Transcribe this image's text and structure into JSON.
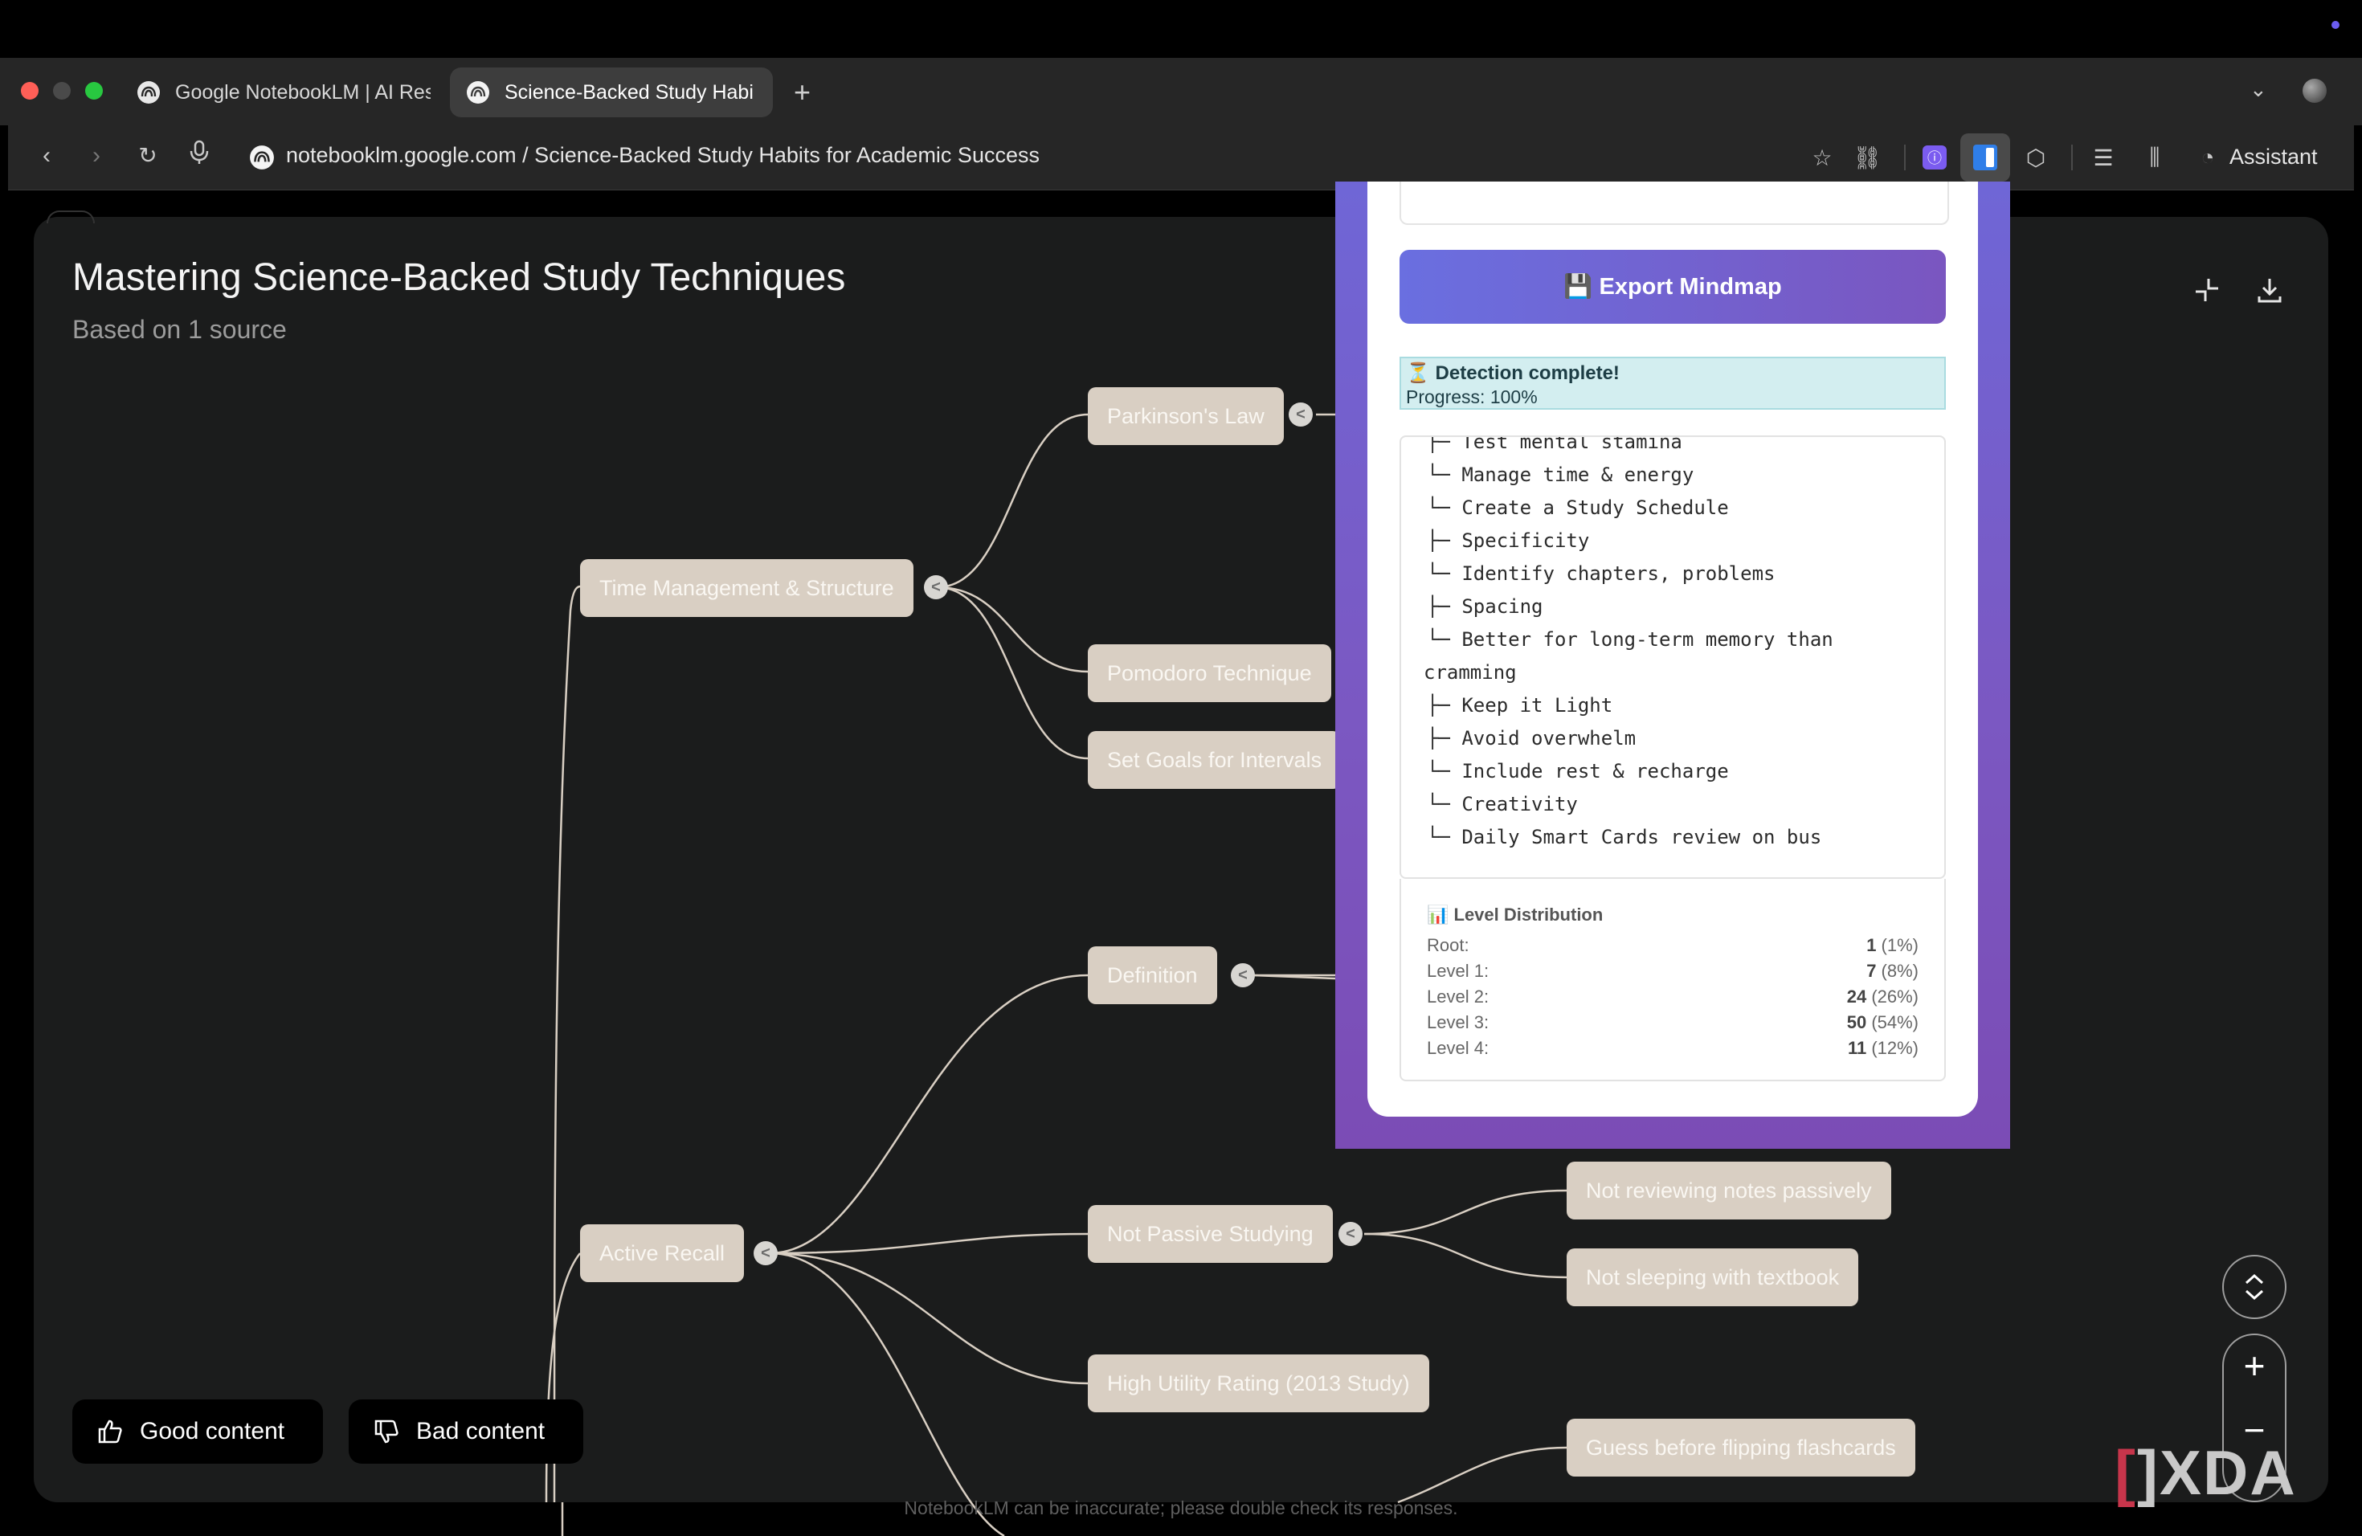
{
  "window": {
    "tabs": [
      {
        "label": "Google NotebookLM | AI Res",
        "active": false
      },
      {
        "label": "Science-Backed Study Habi",
        "active": true
      }
    ],
    "new_tab_symbol": "+",
    "url": "notebooklm.google.com / Science-Backed Study Habits for Academic Success",
    "assistant_label": "Assistant"
  },
  "page": {
    "title": "Mastering Science-Backed Study Techniques",
    "subtitle": "Based on 1 source",
    "footer_note": "NotebookLM can be inaccurate; please double check its responses."
  },
  "mindmap": {
    "nodes": {
      "time_management": "Time Management & Structure",
      "parkinsons_law": "Parkinson's Law",
      "pomodoro": "Pomodoro Technique",
      "set_goals": "Set Goals for Intervals",
      "definition": "Definition",
      "active_recall": "Active Recall",
      "not_passive": "Not Passive Studying",
      "not_reviewing": "Not reviewing notes passively",
      "not_sleeping": "Not sleeping with textbook",
      "high_utility": "High Utility Rating (2013 Study)",
      "guess_before": "Guess before flipping flashcards"
    },
    "toggle_symbol": "<"
  },
  "extension": {
    "export_button": "💾 Export Mindmap",
    "status_title": "⏳ Detection complete!",
    "status_progress": "Progress: 100%",
    "outline": [
      "├─ Test mental stamina",
      "└─ Manage time & energy",
      "└─ Create a Study Schedule",
      "├─ Specificity",
      "└─ Identify chapters, problems",
      "├─ Spacing",
      "└─ Better for long-term memory than",
      "cramming",
      "├─ Keep it Light",
      "├─ Avoid overwhelm",
      "└─ Include rest & recharge",
      "└─ Creativity",
      "└─ Daily Smart Cards review on bus"
    ],
    "distribution": {
      "title": "📊 Level Distribution",
      "rows": [
        {
          "label": "Root:",
          "count": "1",
          "pct": " (1%)"
        },
        {
          "label": "Level 1:",
          "count": "7",
          "pct": " (8%)"
        },
        {
          "label": "Level 2:",
          "count": "24",
          "pct": " (26%)"
        },
        {
          "label": "Level 3:",
          "count": "50",
          "pct": " (54%)"
        },
        {
          "label": "Level 4:",
          "count": "11",
          "pct": " (12%)"
        }
      ]
    }
  },
  "feedback": {
    "good": "Good content",
    "bad": "Bad content"
  },
  "zoom": {
    "plus": "+",
    "minus": "−"
  },
  "watermark": "XDA",
  "colors": {
    "node_bg": "#d9cfc3",
    "canvas_bg": "#1b1c1c",
    "accent_gradient_start": "#6a6fe0",
    "accent_gradient_end": "#7a56c0",
    "status_bg": "#d3eef0"
  }
}
